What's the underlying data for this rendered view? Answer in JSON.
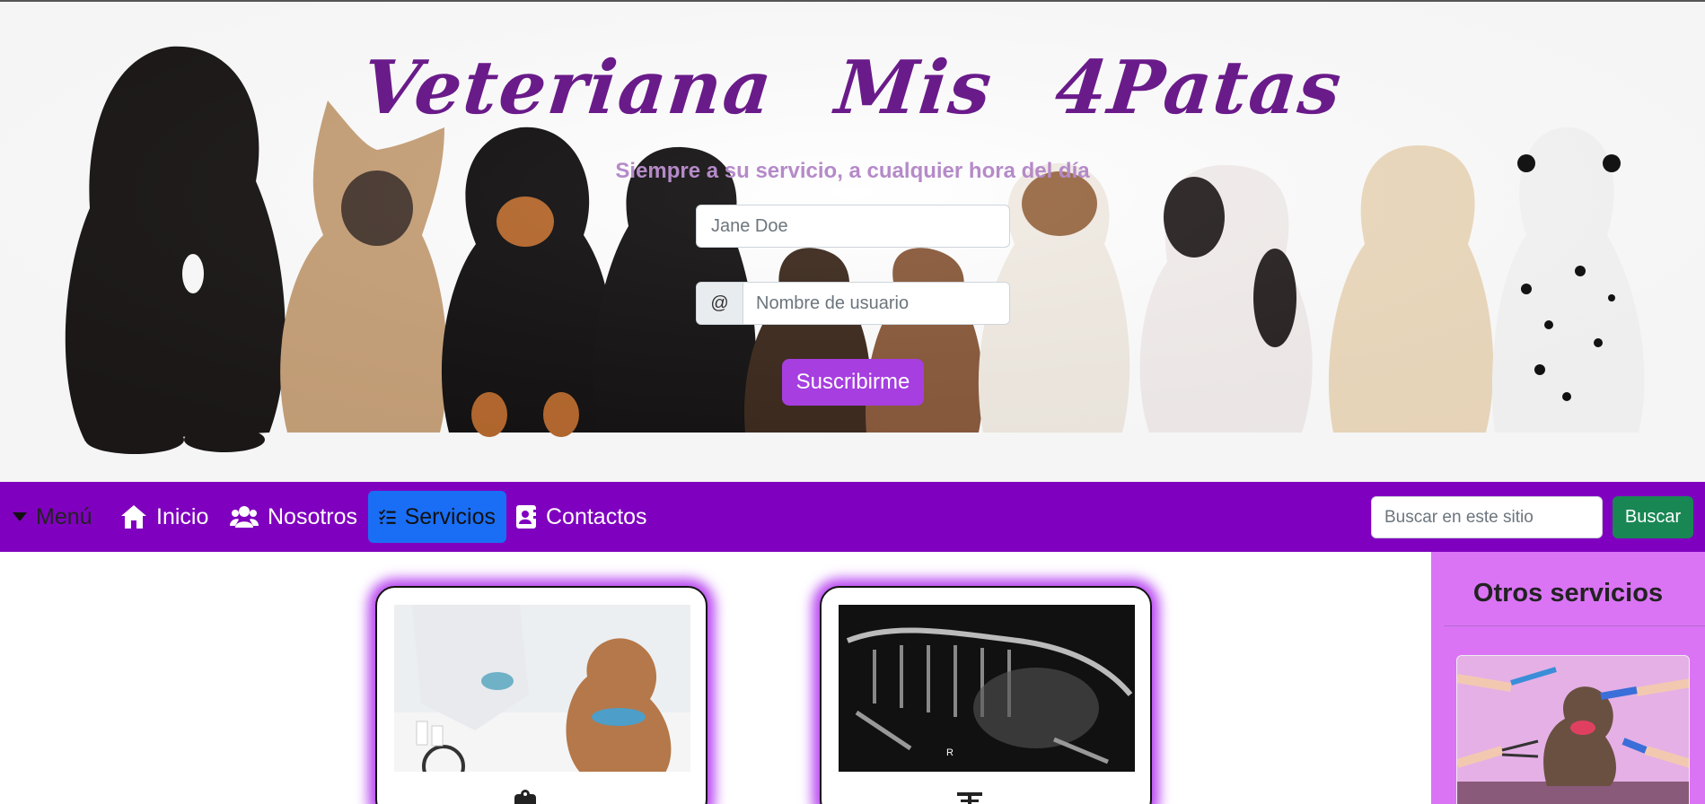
{
  "hero": {
    "title": "Veteriana Mis 4Patas",
    "subtitle": "Siempre a su servicio, a cualquier hora del día",
    "name_placeholder": "Jane Doe",
    "username_addon": "@",
    "username_placeholder": "Nombre de usuario",
    "subscribe_label": "Suscribirme"
  },
  "nav": {
    "menu_label": "Menú",
    "items": [
      {
        "label": "Inicio",
        "icon": "home-icon"
      },
      {
        "label": "Nosotros",
        "icon": "users-icon"
      },
      {
        "label": "Servicios",
        "icon": "list-check-icon",
        "active": true
      },
      {
        "label": "Contactos",
        "icon": "contact-card-icon"
      }
    ],
    "search_placeholder": "Buscar en este sitio",
    "search_button": "Buscar"
  },
  "sidebar": {
    "title": "Otros servicios"
  },
  "colors": {
    "navbar": "#8000bf",
    "active_tab": "#1a6ef5",
    "title_purple": "#6a1b8a",
    "subscribe": "#a63ee0",
    "search_button": "#198754",
    "sidebar_bg": "#da74f5",
    "card_glow": "#b845f0"
  }
}
